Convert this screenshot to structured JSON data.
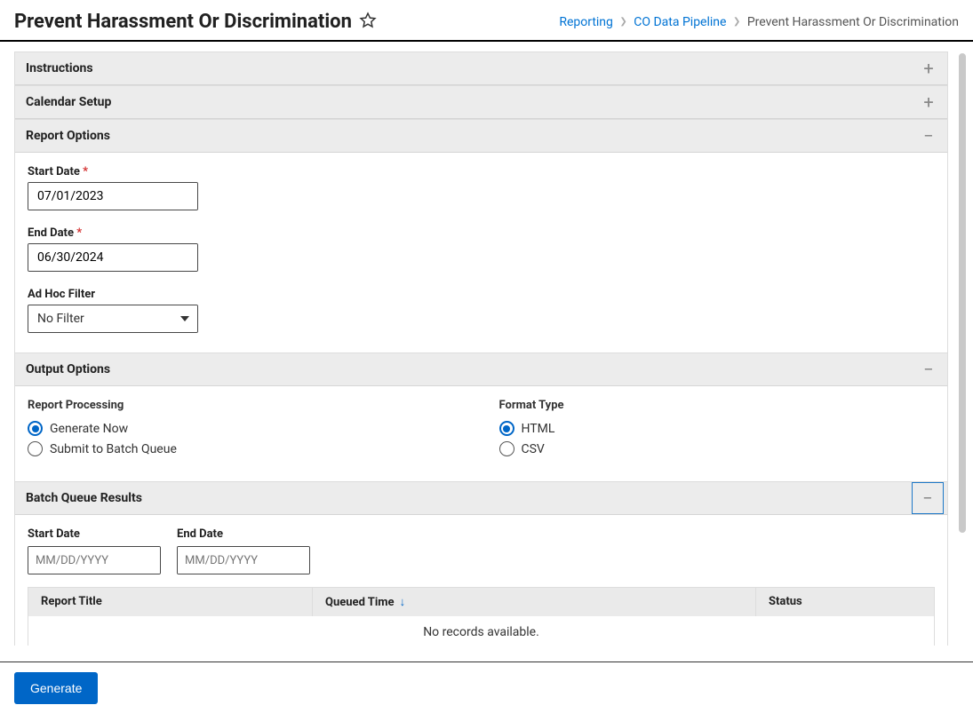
{
  "header": {
    "title": "Prevent Harassment Or Discrimination",
    "breadcrumb": {
      "items": [
        "Reporting",
        "CO Data Pipeline",
        "Prevent Harassment Or Discrimination"
      ]
    }
  },
  "sections": {
    "instructions": {
      "title": "Instructions"
    },
    "calendar_setup": {
      "title": "Calendar Setup"
    },
    "report_options": {
      "title": "Report Options"
    },
    "output_options": {
      "title": "Output Options"
    },
    "batch_queue": {
      "title": "Batch Queue Results"
    }
  },
  "report_options": {
    "start_date_label": "Start Date",
    "start_date_value": "07/01/2023",
    "end_date_label": "End Date",
    "end_date_value": "06/30/2024",
    "adhoc_label": "Ad Hoc Filter",
    "adhoc_value": "No Filter"
  },
  "output_options": {
    "processing_label": "Report Processing",
    "processing_opts": [
      "Generate Now",
      "Submit to Batch Queue"
    ],
    "format_label": "Format Type",
    "format_opts": [
      "HTML",
      "CSV"
    ]
  },
  "batch_queue": {
    "start_date_label": "Start Date",
    "end_date_label": "End Date",
    "placeholder": "MM/DD/YYYY",
    "columns": [
      "Report Title",
      "Queued Time",
      "Status"
    ],
    "empty_text": "No records available."
  },
  "footer": {
    "generate": "Generate"
  }
}
